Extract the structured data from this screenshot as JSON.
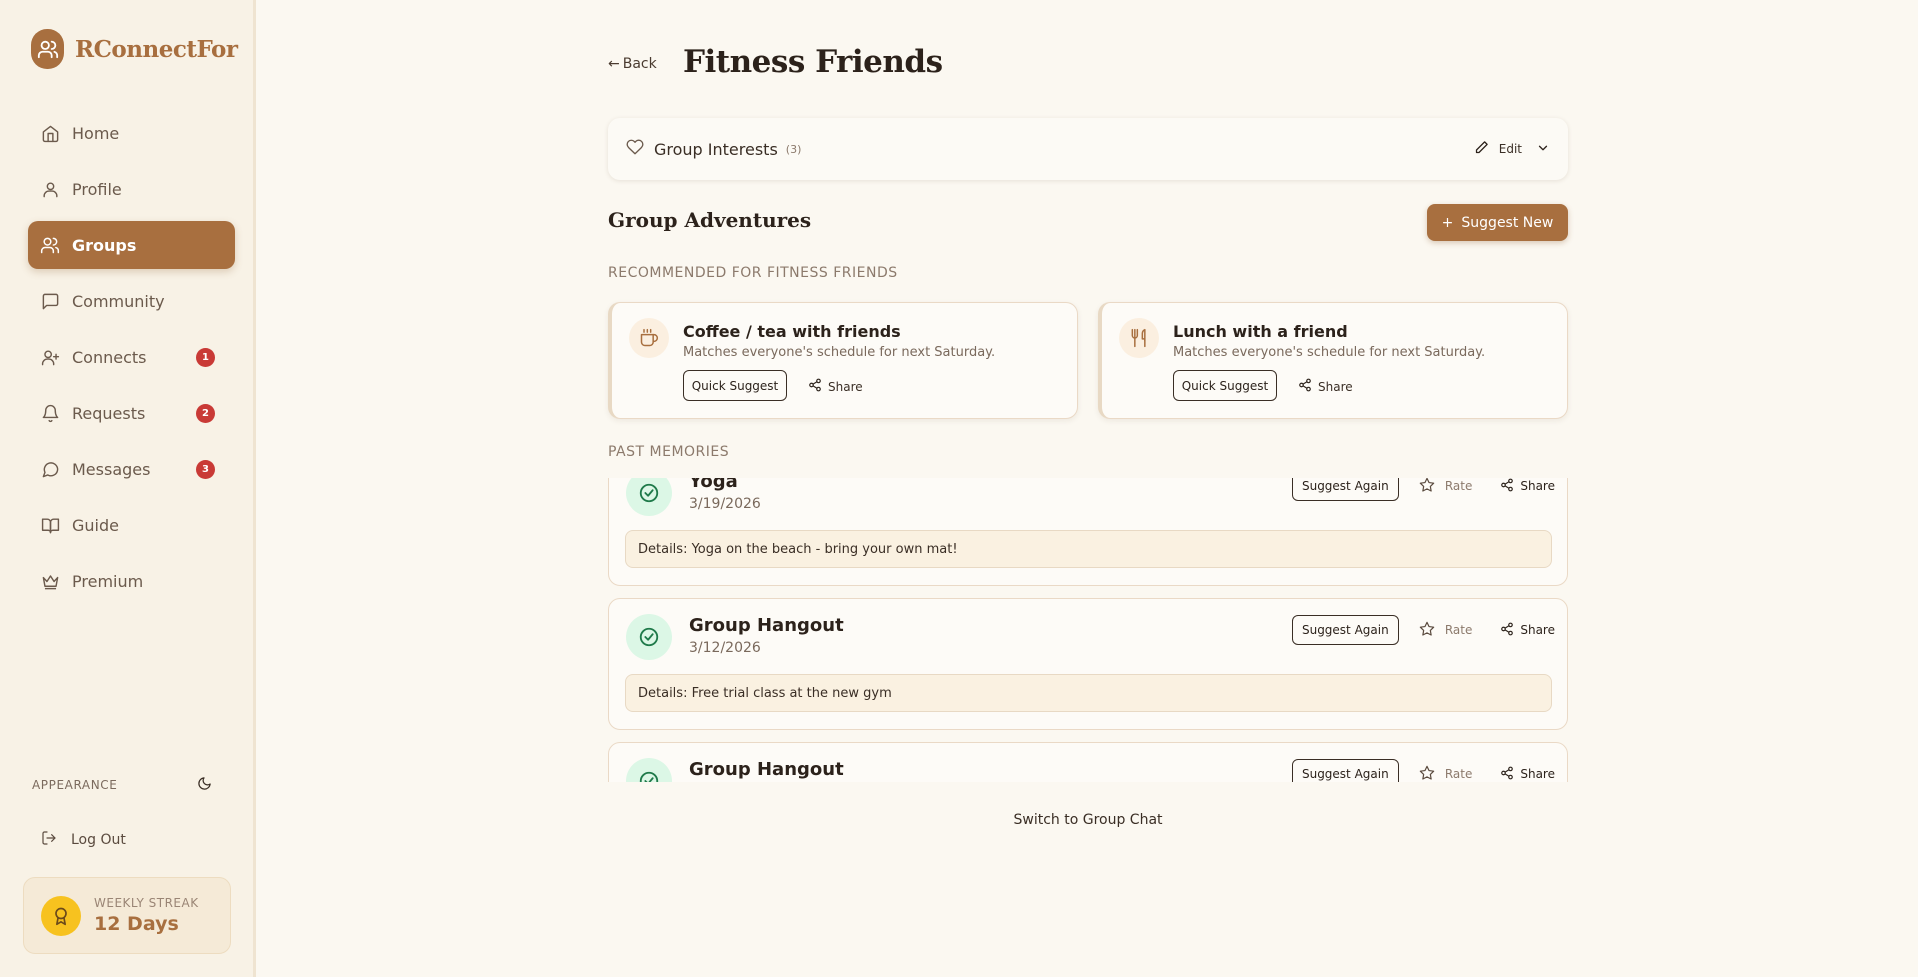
{
  "app": {
    "name": "RConnectFor"
  },
  "sidebar": {
    "items": [
      {
        "label": "Home",
        "icon": "home-icon"
      },
      {
        "label": "Profile",
        "icon": "user-icon"
      },
      {
        "label": "Groups",
        "icon": "users-icon",
        "active": true
      },
      {
        "label": "Community",
        "icon": "chat-square-icon"
      },
      {
        "label": "Connects",
        "icon": "user-plus-icon",
        "badge": "1"
      },
      {
        "label": "Requests",
        "icon": "bell-icon",
        "badge": "2"
      },
      {
        "label": "Messages",
        "icon": "message-circle-icon",
        "badge": "3"
      },
      {
        "label": "Guide",
        "icon": "book-icon"
      },
      {
        "label": "Premium",
        "icon": "crown-icon"
      }
    ],
    "appearance_label": "APPEARANCE",
    "logout_label": "Log Out",
    "streak": {
      "label": "WEEKLY STREAK",
      "value": "12 Days"
    }
  },
  "header": {
    "back_label": "Back",
    "title": "Fitness Friends"
  },
  "interests": {
    "title": "Group Interests",
    "count": "(3)",
    "edit_label": "Edit"
  },
  "adventures": {
    "title": "Group Adventures",
    "suggest_new_label": "Suggest New",
    "recommended_label": "RECOMMENDED FOR FITNESS FRIENDS",
    "recommendations": [
      {
        "title": "Coffee / tea with friends",
        "desc": "Matches everyone's schedule for next Saturday.",
        "icon": "coffee-icon",
        "quick_label": "Quick Suggest",
        "share_label": "Share"
      },
      {
        "title": "Lunch with a friend",
        "desc": "Matches everyone's schedule for next Saturday.",
        "icon": "utensils-icon",
        "quick_label": "Quick Suggest",
        "share_label": "Share"
      }
    ],
    "past_label": "PAST MEMORIES",
    "memories": [
      {
        "title": "Yoga",
        "date": "3/19/2026",
        "details": "Details: Yoga on the beach - bring your own mat!",
        "again_label": "Suggest Again",
        "rate_label": "Rate",
        "share_label": "Share"
      },
      {
        "title": "Group Hangout",
        "date": "3/12/2026",
        "details": "Details: Free trial class at the new gym",
        "again_label": "Suggest Again",
        "rate_label": "Rate",
        "share_label": "Share"
      },
      {
        "title": "Group Hangout",
        "date": "",
        "details": "",
        "again_label": "Suggest Again",
        "rate_label": "Rate",
        "share_label": "Share"
      }
    ],
    "switch_chat_label": "Switch to Group Chat"
  },
  "colors": {
    "accent": "#a86f3f",
    "background": "#fbf8f1",
    "sidebar": "#f8f2e6",
    "badge": "#c93a36",
    "streak": "#f7c21f",
    "success": "#dcf7e6"
  }
}
